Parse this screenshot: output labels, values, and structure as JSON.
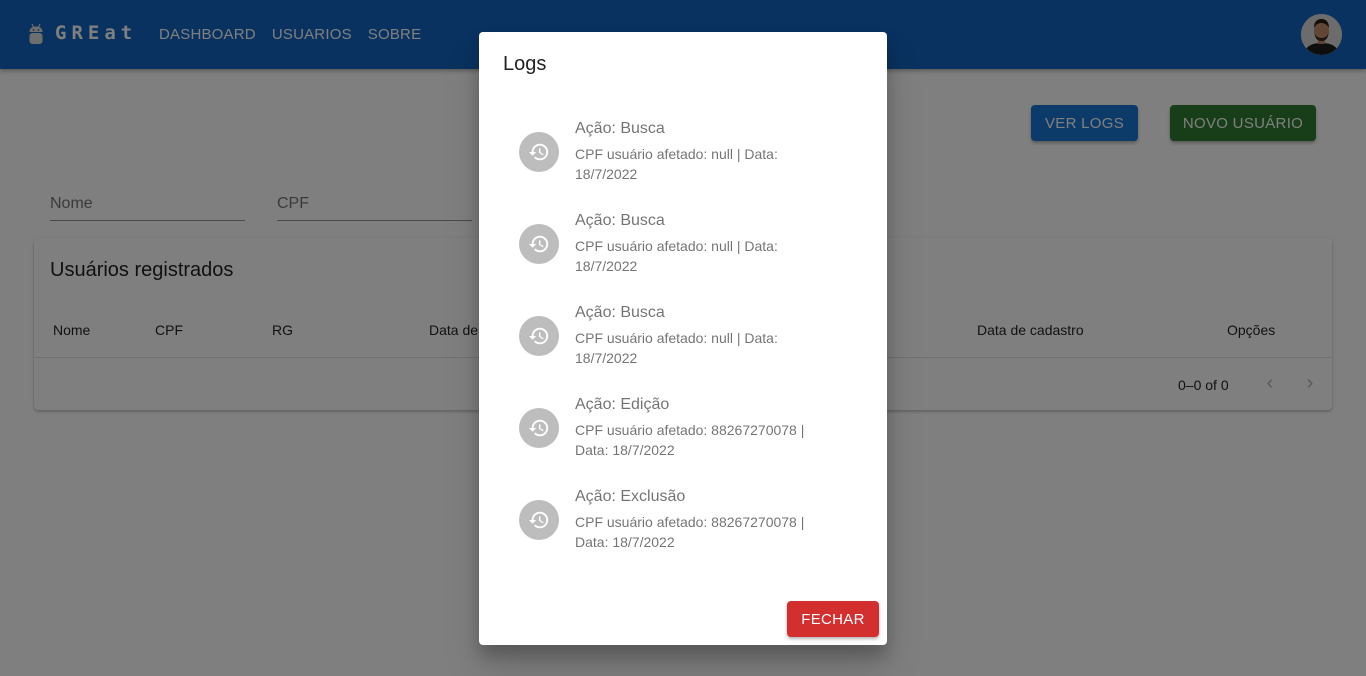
{
  "app": {
    "brand": "GREat",
    "nav": [
      "DASHBOARD",
      "USUARIOS",
      "SOBRE"
    ],
    "colors": {
      "appbar": "#1565c0",
      "logs_button": "#1976d2",
      "new_button": "#2e7d32",
      "close_button": "#d32f2f"
    }
  },
  "toolbar": {
    "logs_label": "VER LOGS",
    "new_user_label": "NOVO USUÁRIO"
  },
  "filters": {
    "nome_placeholder": "Nome",
    "cpf_placeholder": "CPF"
  },
  "table": {
    "title": "Usuários registrados",
    "headers": [
      "Nome",
      "CPF",
      "RG",
      "Data de",
      "Data de cadastro",
      "Opções"
    ],
    "pagination": "0–0 of 0"
  },
  "dialog": {
    "title": "Logs",
    "items": [
      {
        "primary": "Ação: Busca",
        "secondary": "CPF usuário afetado: null | Data: 18/7/2022",
        "icon": "history-icon"
      },
      {
        "primary": "Ação: Busca",
        "secondary": "CPF usuário afetado: null | Data: 18/7/2022",
        "icon": "history-icon"
      },
      {
        "primary": "Ação: Busca",
        "secondary": "CPF usuário afetado: null | Data: 18/7/2022",
        "icon": "history-icon"
      },
      {
        "primary": "Ação: Edição",
        "secondary": "CPF usuário afetado: 88267270078 | Data: 18/7/2022",
        "icon": "history-icon"
      },
      {
        "primary": "Ação: Exclusão",
        "secondary": "CPF usuário afetado: 88267270078 | Data: 18/7/2022",
        "icon": "history-icon"
      }
    ],
    "close_label": "FECHAR"
  }
}
